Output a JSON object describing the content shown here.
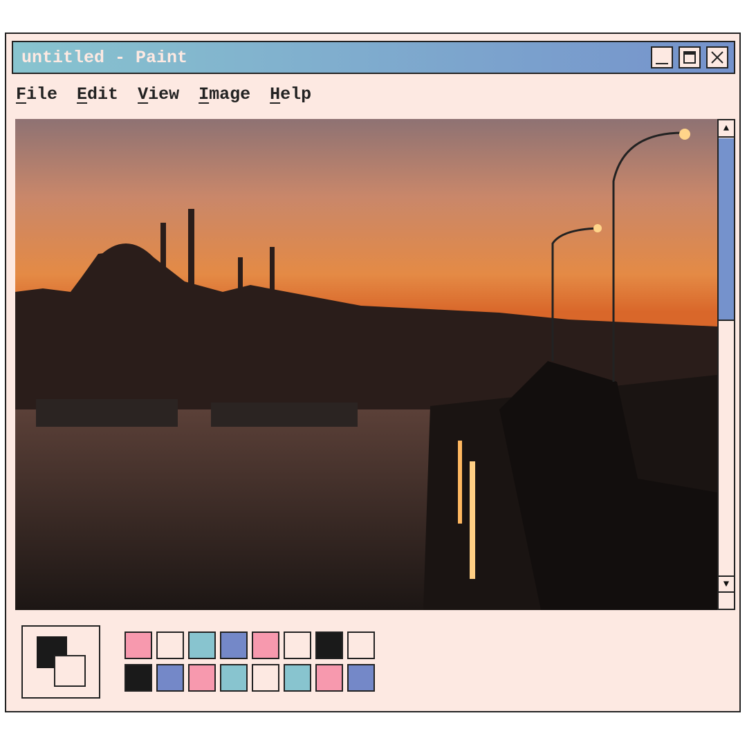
{
  "window": {
    "title": "untitled - Paint"
  },
  "title_buttons": [
    "minimize-icon",
    "maximize-icon",
    "close-icon"
  ],
  "menu": [
    {
      "label": "File"
    },
    {
      "label": "Edit"
    },
    {
      "label": "View"
    },
    {
      "label": "Image"
    },
    {
      "label": "Help"
    }
  ],
  "canvas": {
    "description_icon": "photo-canvas"
  },
  "scrollbar": {
    "position_fraction": 0.0,
    "visible_fraction": 0.39
  },
  "colors": {
    "foreground": "#1a1a1a",
    "background": "#fde9e2"
  },
  "palette": [
    "#f799ae",
    "#fde9e2",
    "#88c4cf",
    "#7488c8",
    "#f799ae",
    "#fde9e2",
    "#1a1a1a",
    "#fde9e2",
    "#1a1a1a",
    "#7488c8",
    "#f799ae",
    "#88c4cf",
    "#fde9e2",
    "#88c4cf",
    "#f799ae",
    "#7488c8"
  ]
}
